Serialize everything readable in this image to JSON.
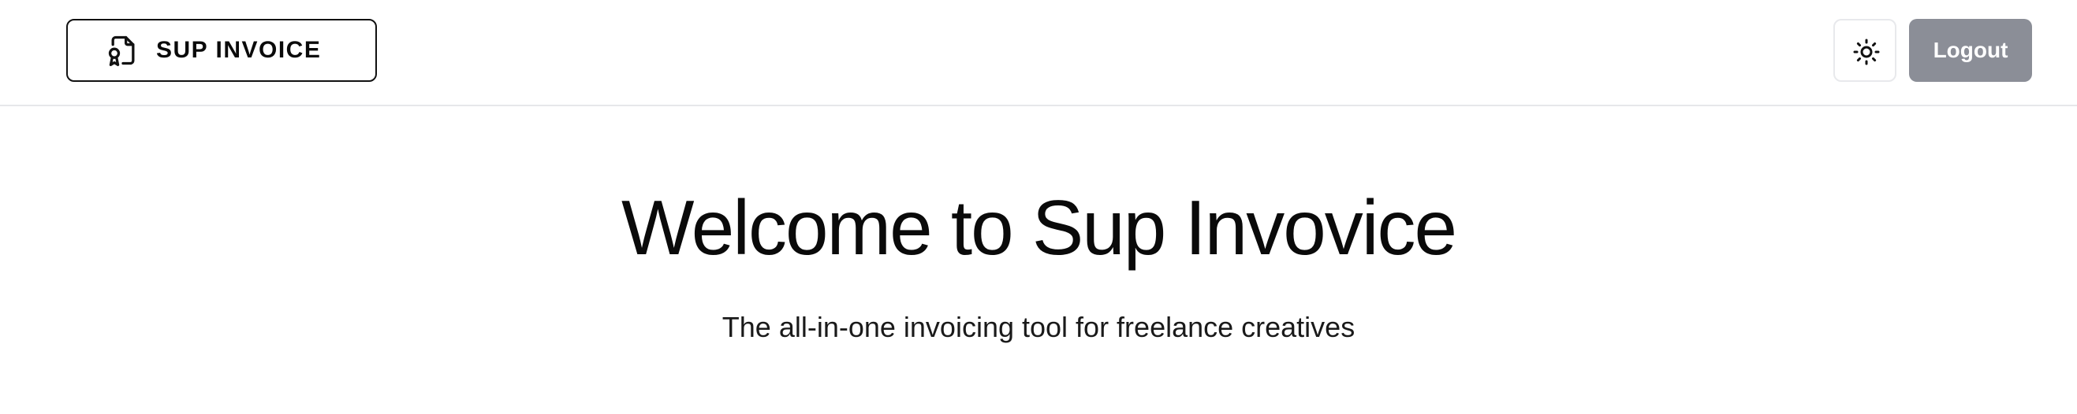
{
  "header": {
    "logo": {
      "text": "SUP INVOICE",
      "icon": "file-certificate-icon"
    },
    "theme_toggle": {
      "icon": "sun-icon"
    },
    "logout_label": "Logout"
  },
  "hero": {
    "title": "Welcome to Sup Invovice",
    "subtitle": "The all-in-one invoicing tool for freelance creatives"
  },
  "colors": {
    "logout_bg": "#8b8e97",
    "text": "#0a0a0a",
    "border": "#e6e7ea"
  }
}
